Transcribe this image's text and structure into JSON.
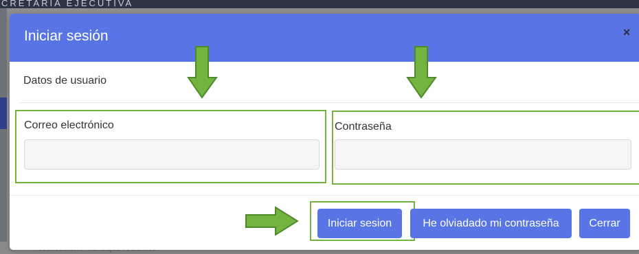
{
  "background": {
    "header_text": "CRETARIA EJECUTIVA",
    "bottom_text": "Notificación / Mensajes recientes"
  },
  "modal": {
    "title": "Iniciar sesión",
    "close_icon": "×",
    "section_title": "Datos de usuario",
    "email": {
      "label": "Correo electrónico",
      "value": "",
      "placeholder": ""
    },
    "password": {
      "label": "Contraseña",
      "value": "",
      "placeholder": ""
    },
    "buttons": {
      "login": "Iniciar sesion",
      "forgot": "He olviadado mi contraseña",
      "close": "Cerrar"
    }
  },
  "colors": {
    "accent": "#5874e5",
    "annotation": "#73b33f",
    "input_bg": "#f5f5f5"
  },
  "annotations": {
    "icons": [
      "arrow-down-icon",
      "arrow-down-icon",
      "arrow-right-icon"
    ],
    "highlight_targets": [
      "email-field",
      "password-field",
      "login-button"
    ]
  }
}
